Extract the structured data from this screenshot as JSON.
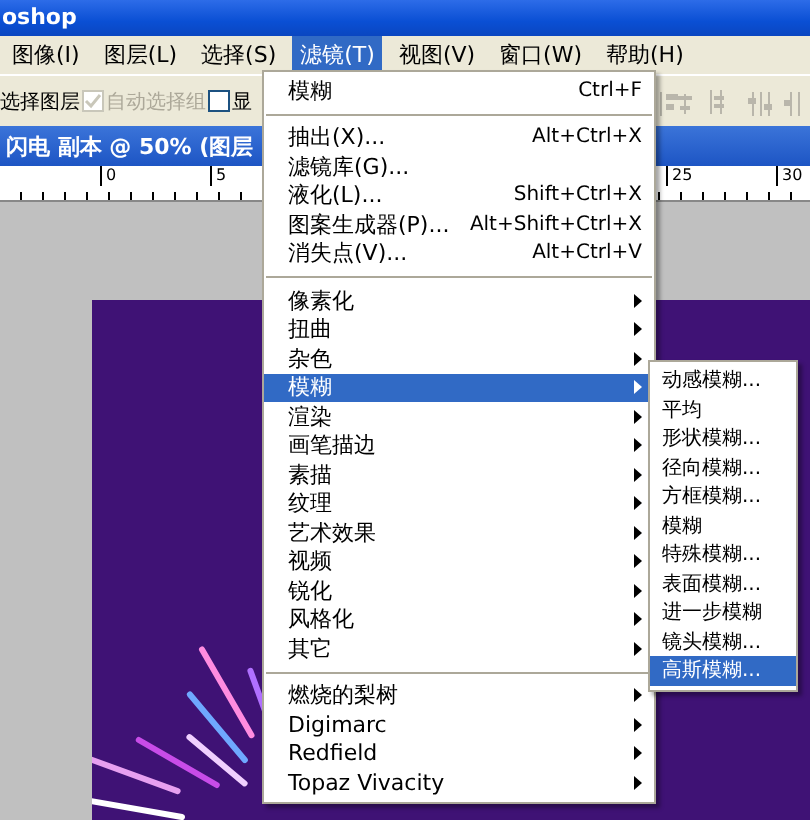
{
  "window": {
    "title": "oshop"
  },
  "menu_bar": [
    {
      "label": "图像(I)",
      "selected": false
    },
    {
      "label": "图层(L)",
      "selected": false
    },
    {
      "label": "选择(S)",
      "selected": false
    },
    {
      "label": "滤镜(T)",
      "selected": true
    },
    {
      "label": "视图(V)",
      "selected": false
    },
    {
      "label": "窗口(W)",
      "selected": false
    },
    {
      "label": "帮助(H)",
      "selected": false
    }
  ],
  "options_bar": {
    "label": "选择图层",
    "checkboxes": [
      {
        "label": "自动选择组",
        "checked": true,
        "disabled": true
      },
      {
        "label": "显",
        "checked": false,
        "disabled": false
      }
    ]
  },
  "document": {
    "title": "闪电 副本 @ 50% (图层"
  },
  "ruler": {
    "labels": [
      "0",
      "5",
      "25",
      "30"
    ]
  },
  "filter_menu": {
    "items": [
      {
        "kind": "item",
        "label": "模糊",
        "shortcut": "Ctrl+F",
        "selected": false
      },
      {
        "kind": "separator"
      },
      {
        "kind": "item",
        "label": "抽出(X)...",
        "shortcut": "Alt+Ctrl+X",
        "selected": false
      },
      {
        "kind": "item",
        "label": "滤镜库(G)...",
        "selected": false
      },
      {
        "kind": "item",
        "label": "液化(L)...",
        "shortcut": "Shift+Ctrl+X",
        "selected": false
      },
      {
        "kind": "item",
        "label": "图案生成器(P)...",
        "shortcut": "Alt+Shift+Ctrl+X",
        "selected": false
      },
      {
        "kind": "item",
        "label": "消失点(V)...",
        "shortcut": "Alt+Ctrl+V",
        "selected": false
      },
      {
        "kind": "separator"
      },
      {
        "kind": "submenu",
        "label": "像素化",
        "selected": false
      },
      {
        "kind": "submenu",
        "label": "扭曲",
        "selected": false
      },
      {
        "kind": "submenu",
        "label": "杂色",
        "selected": false
      },
      {
        "kind": "submenu",
        "label": "模糊",
        "selected": true
      },
      {
        "kind": "submenu",
        "label": "渲染",
        "selected": false
      },
      {
        "kind": "submenu",
        "label": "画笔描边",
        "selected": false
      },
      {
        "kind": "submenu",
        "label": "素描",
        "selected": false
      },
      {
        "kind": "submenu",
        "label": "纹理",
        "selected": false
      },
      {
        "kind": "submenu",
        "label": "艺术效果",
        "selected": false
      },
      {
        "kind": "submenu",
        "label": "视频",
        "selected": false
      },
      {
        "kind": "submenu",
        "label": "锐化",
        "selected": false
      },
      {
        "kind": "submenu",
        "label": "风格化",
        "selected": false
      },
      {
        "kind": "submenu",
        "label": "其它",
        "selected": false
      },
      {
        "kind": "separator"
      },
      {
        "kind": "submenu",
        "label": "燃烧的梨树",
        "selected": false
      },
      {
        "kind": "submenu",
        "label": "Digimarc",
        "selected": false
      },
      {
        "kind": "submenu",
        "label": "Redfield",
        "selected": false
      },
      {
        "kind": "submenu",
        "label": "Topaz Vivacity",
        "selected": false
      }
    ]
  },
  "blur_submenu": {
    "items": [
      {
        "label": "动感模糊...",
        "selected": false
      },
      {
        "label": "平均",
        "selected": false
      },
      {
        "label": "形状模糊...",
        "selected": false
      },
      {
        "label": "径向模糊...",
        "selected": false
      },
      {
        "label": "方框模糊...",
        "selected": false
      },
      {
        "label": "模糊",
        "selected": false
      },
      {
        "label": "特殊模糊...",
        "selected": false
      },
      {
        "label": "表面模糊...",
        "selected": false
      },
      {
        "label": "进一步模糊",
        "selected": false
      },
      {
        "label": "镜头模糊...",
        "selected": false
      },
      {
        "label": "高斯模糊...",
        "selected": true
      }
    ]
  }
}
